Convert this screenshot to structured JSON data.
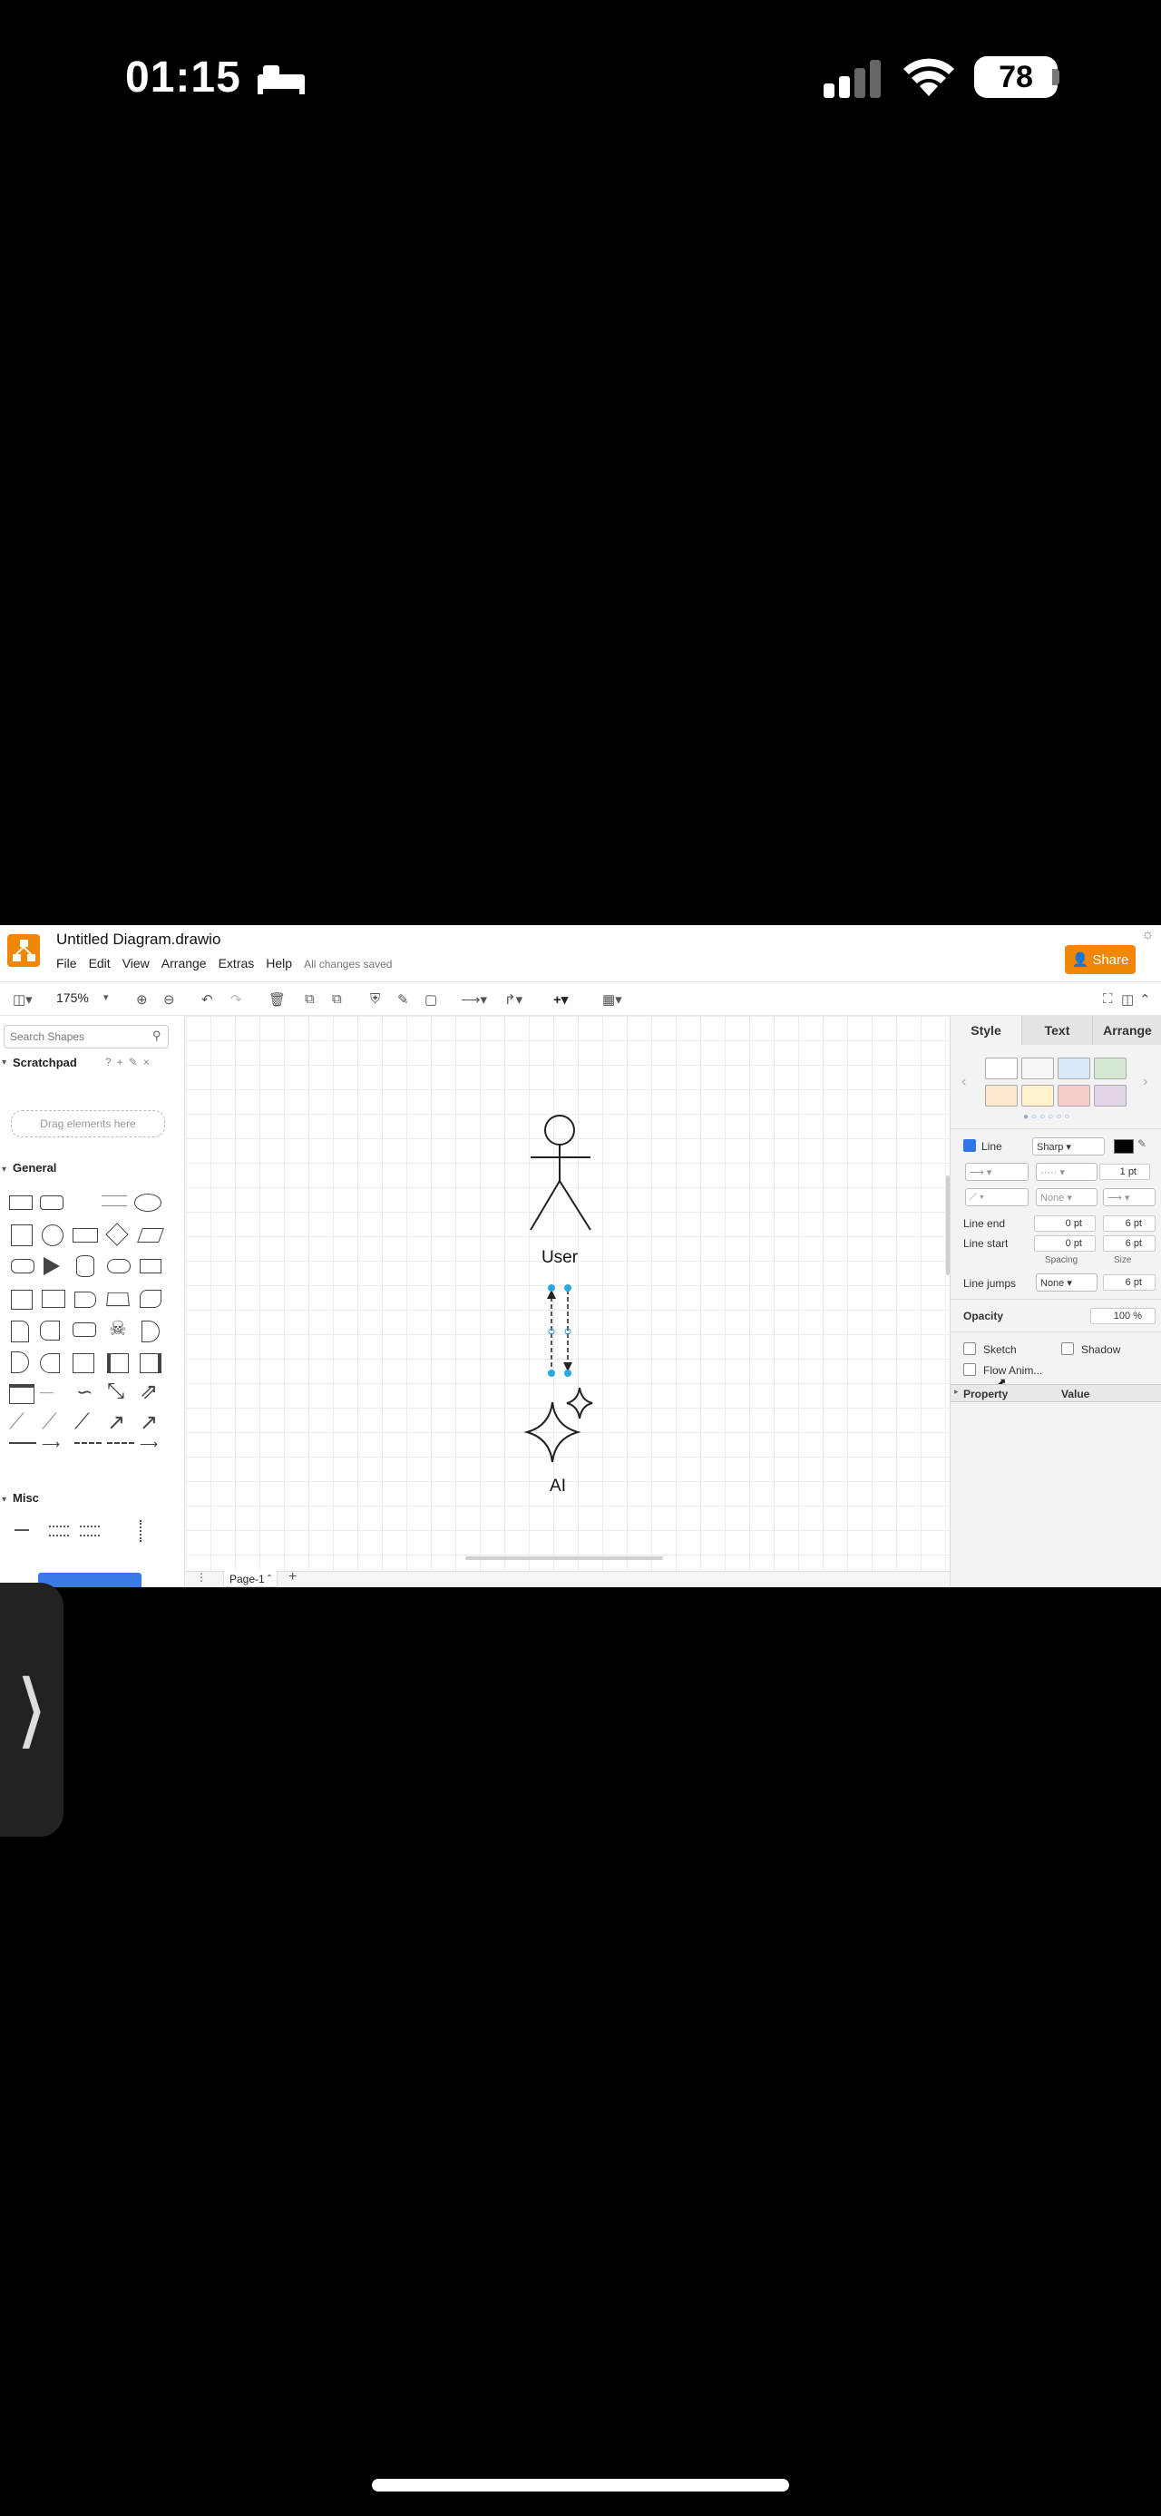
{
  "status_bar": {
    "time": "01:15",
    "battery": "78"
  },
  "app": {
    "document_title": "Untitled Diagram.drawio",
    "menu": [
      "File",
      "Edit",
      "View",
      "Arrange",
      "Extras",
      "Help"
    ],
    "save_status": "All changes saved",
    "share_label": "Share",
    "zoom": "175%"
  },
  "left_panel": {
    "search_placeholder": "Search Shapes",
    "scratchpad": "Scratchpad",
    "drop_hint": "Drag elements here",
    "general": "General",
    "misc": "Misc"
  },
  "canvas": {
    "actor_label": "User",
    "ai_label": "AI",
    "page_tab": "Page-1"
  },
  "right_panel": {
    "tabs": [
      "Style",
      "Text",
      "Arrange"
    ],
    "line_label": "Line",
    "line_style": "Sharp",
    "line_width": "1 pt",
    "end_none": "None",
    "line_end_label": "Line end",
    "line_end_spacing": "0 pt",
    "line_end_size": "6 pt",
    "line_start_label": "Line start",
    "line_start_spacing": "0 pt",
    "line_start_size": "6 pt",
    "spacing_label": "Spacing",
    "size_label": "Size",
    "line_jumps_label": "Line jumps",
    "line_jumps_value": "None",
    "line_jumps_size": "6 pt",
    "opacity_label": "Opacity",
    "opacity_value": "100 %",
    "sketch_label": "Sketch",
    "shadow_label": "Shadow",
    "flow_anim_label": "Flow Anim...",
    "property_header": "Property",
    "value_header": "Value",
    "swatch_colors": [
      "#ffffff",
      "#f5f5f5",
      "#dae8fc",
      "#d5e8d4",
      "#ffe6cc",
      "#fff2cc",
      "#f8cecc",
      "#e1d5e7"
    ]
  }
}
